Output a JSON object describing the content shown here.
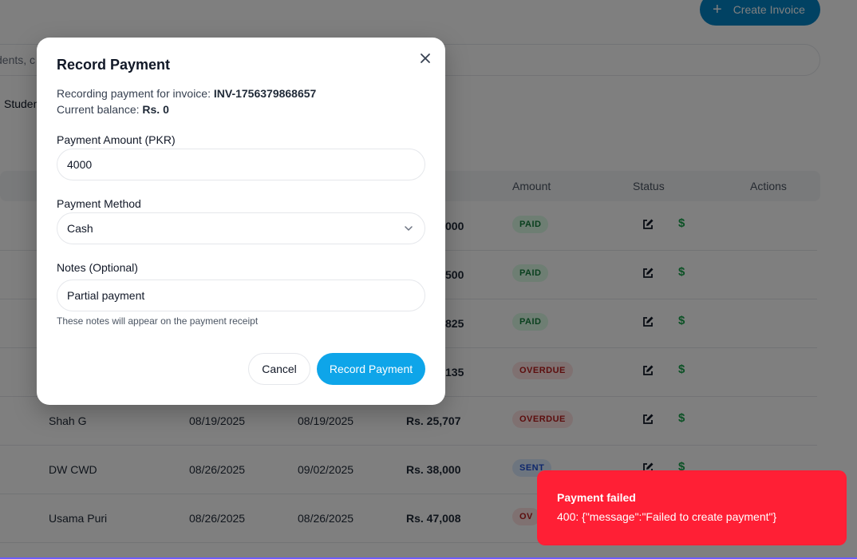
{
  "header": {
    "create_invoice_label": "Create Invoice"
  },
  "search": {
    "placeholder": "dents, c"
  },
  "tabs": {
    "students_label": "Studen"
  },
  "table": {
    "columns": {
      "due_date": "e",
      "amount": "Amount",
      "status": "Status",
      "actions": "Actions"
    },
    "rows": [
      {
        "name": "",
        "issue": "",
        "due": "",
        "amount": "000",
        "status": "PAID",
        "status_type": "paid"
      },
      {
        "name": "",
        "issue": "",
        "due": "",
        "amount": "500",
        "status": "PAID",
        "status_type": "paid"
      },
      {
        "name": "",
        "issue": "",
        "due": "",
        "amount": "825",
        "status": "PAID",
        "status_type": "paid"
      },
      {
        "name": "",
        "issue": "",
        "due": "",
        "amount": "135",
        "status": "OVERDUE",
        "status_type": "overdue"
      },
      {
        "name": "Shah G",
        "issue": "08/19/2025",
        "due": "08/19/2025",
        "amount": "Rs. 25,707",
        "status": "OVERDUE",
        "status_type": "overdue"
      },
      {
        "name": "DW CWD",
        "issue": "08/26/2025",
        "due": "09/02/2025",
        "amount": "Rs. 38,000",
        "status": "SENT",
        "status_type": "sent"
      },
      {
        "name": "Usama Puri",
        "issue": "08/26/2025",
        "due": "08/26/2025",
        "amount": "Rs. 47,008",
        "status": "OV",
        "status_type": "overdue"
      }
    ]
  },
  "modal": {
    "title": "Record Payment",
    "invoice_prefix": "Recording payment for invoice: ",
    "invoice_number": "INV-1756379868657",
    "balance_prefix": "Current balance: ",
    "balance_value": "Rs. 0",
    "amount_label": "Payment Amount (PKR)",
    "amount_value": "4000",
    "method_label": "Payment Method",
    "method_value": "Cash",
    "notes_label": "Notes (Optional)",
    "notes_value": "Partial payment",
    "notes_hint": "These notes will appear on the payment receipt",
    "cancel_label": "Cancel",
    "submit_label": "Record Payment"
  },
  "toast": {
    "title": "Payment failed",
    "message": "400: {\"message\":\"Failed to create payment\"}"
  },
  "colors": {
    "primary": "#0ea5e9",
    "error": "#ff1f35",
    "paid": "#15803d",
    "overdue": "#b91c1c",
    "sent": "#1d4ed8"
  }
}
